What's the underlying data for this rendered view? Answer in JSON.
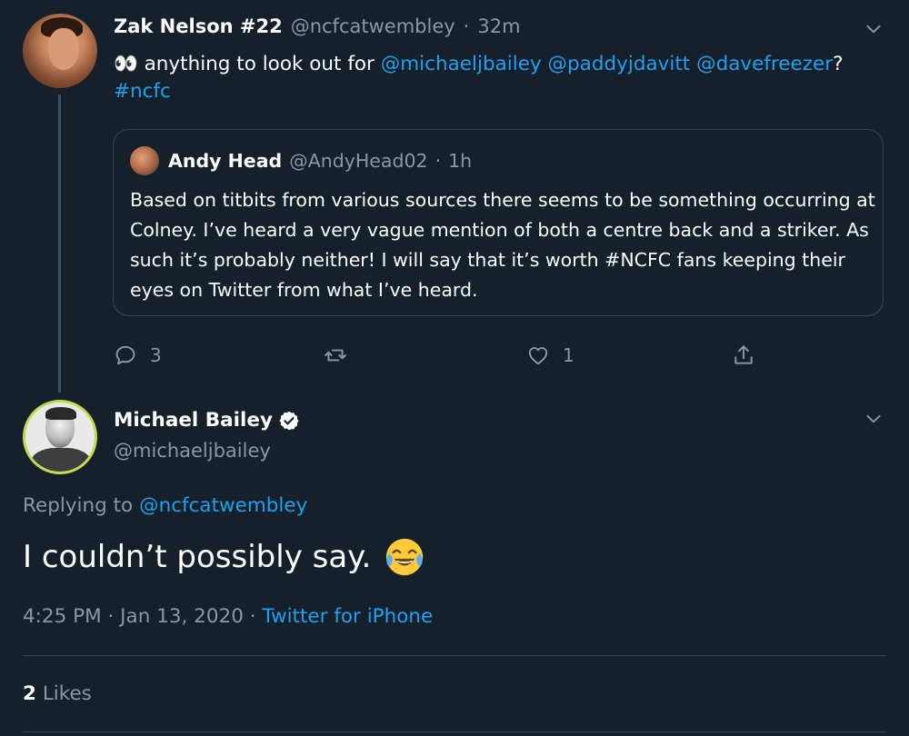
{
  "parent_tweet": {
    "display_name": "Zak Nelson #22",
    "handle": "@ncfcatwembley",
    "separator": "·",
    "time": "32m",
    "text_prefix_emoji": "👀",
    "text_plain": "anything to look out for",
    "mention_1": "@michaeljbailey",
    "mention_2": "@paddyjdavitt",
    "mention_3": "@davefreezer",
    "question_mark": "?",
    "hashtag": "#ncfc",
    "quote": {
      "display_name": "Andy Head",
      "handle": "@AndyHead02",
      "separator": "·",
      "time": "1h",
      "text": "Based on titbits from various sources there seems to be something occurring at Colney. I’ve heard a very vague mention of both a centre back and a striker. As such it’s probably neither! I will say that it’s worth #NCFC fans keeping their eyes on Twitter from what I’ve heard."
    },
    "actions": {
      "reply_count": "3",
      "retweet_count": "",
      "like_count": "1"
    }
  },
  "main_tweet": {
    "display_name": "Michael Bailey",
    "handle": "@michaeljbailey",
    "replying_label": "Replying to",
    "replying_to": "@ncfcatwembley",
    "text": "I couldn’t possibly say.",
    "time": "4:25 PM",
    "sep1": "·",
    "date": "Jan 13, 2020",
    "sep2": "·",
    "source": "Twitter for iPhone",
    "likes_count": "2",
    "likes_label": "Likes"
  },
  "icons": {
    "reply": "reply-icon",
    "retweet": "retweet-icon",
    "like": "heart-icon",
    "share": "share-icon",
    "more": "chevron-down-icon",
    "verified": "verified-badge-icon",
    "emoji": "face-with-tears-of-joy"
  },
  "colors": {
    "background": "#15202b",
    "link": "#1da1f2",
    "secondary_text": "#8899a6",
    "border": "#38444d"
  }
}
